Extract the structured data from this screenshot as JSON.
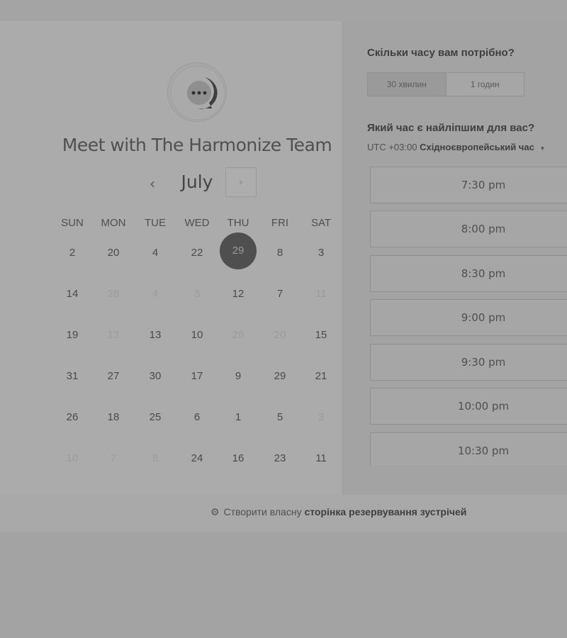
{
  "brand": {
    "meeting_title": "Meet with The Harmonize Team",
    "logo_icon": "chat-bubble-logo-icon"
  },
  "calendar": {
    "month": "July",
    "prev_icon": "‹",
    "next_icon": "›",
    "weekdays": [
      "SUN",
      "MON",
      "TUE",
      "WED",
      "THU",
      "FRI",
      "SAT"
    ],
    "weeks": [
      [
        {
          "d": "2"
        },
        {
          "d": "20"
        },
        {
          "d": "4"
        },
        {
          "d": "22"
        },
        {
          "d": "29",
          "selected": true
        },
        {
          "d": "8"
        },
        {
          "d": "3"
        }
      ],
      [
        {
          "d": "14"
        },
        {
          "d": "28",
          "muted": true
        },
        {
          "d": "4",
          "muted": true
        },
        {
          "d": "3",
          "muted": true
        },
        {
          "d": "12"
        },
        {
          "d": "7"
        },
        {
          "d": "11",
          "muted": true
        }
      ],
      [
        {
          "d": "19"
        },
        {
          "d": "13",
          "muted": true
        },
        {
          "d": "13"
        },
        {
          "d": "10"
        },
        {
          "d": "26",
          "muted": true
        },
        {
          "d": "20",
          "muted": true
        },
        {
          "d": "15"
        }
      ],
      [
        {
          "d": "31"
        },
        {
          "d": "27"
        },
        {
          "d": "30"
        },
        {
          "d": "17"
        },
        {
          "d": "9"
        },
        {
          "d": "29"
        },
        {
          "d": "21"
        }
      ],
      [
        {
          "d": "26"
        },
        {
          "d": "18"
        },
        {
          "d": "25"
        },
        {
          "d": "6"
        },
        {
          "d": "1"
        },
        {
          "d": "5"
        },
        {
          "d": "3",
          "muted": true
        }
      ],
      [
        {
          "d": "10",
          "muted": true
        },
        {
          "d": "7",
          "muted": true
        },
        {
          "d": "8",
          "muted": true
        },
        {
          "d": "24"
        },
        {
          "d": "16"
        },
        {
          "d": "23"
        },
        {
          "d": "11"
        }
      ]
    ]
  },
  "duration": {
    "heading": "Скільки часу вам потрібно?",
    "options": [
      "30 хвилин",
      "1 годин"
    ],
    "selected": "30 хвилин"
  },
  "time_select": {
    "heading": "Який час є найліпшим для вас?",
    "timezone_offset": "UTC +03:00",
    "timezone_name": "Східноєвропейський час",
    "slots": [
      "7:30 pm",
      "8:00 pm",
      "8:30 pm",
      "9:00 pm",
      "9:30 pm",
      "10:00 pm",
      "10:30 pm"
    ]
  },
  "footer": {
    "prefix": "Створити власну",
    "link": "сторінка резервування зустрічей",
    "icon": "hubspot-sprocket-icon"
  },
  "colors": {
    "overlay_bg": "#a3a3a3",
    "selected_day": "#4f4f4f"
  }
}
